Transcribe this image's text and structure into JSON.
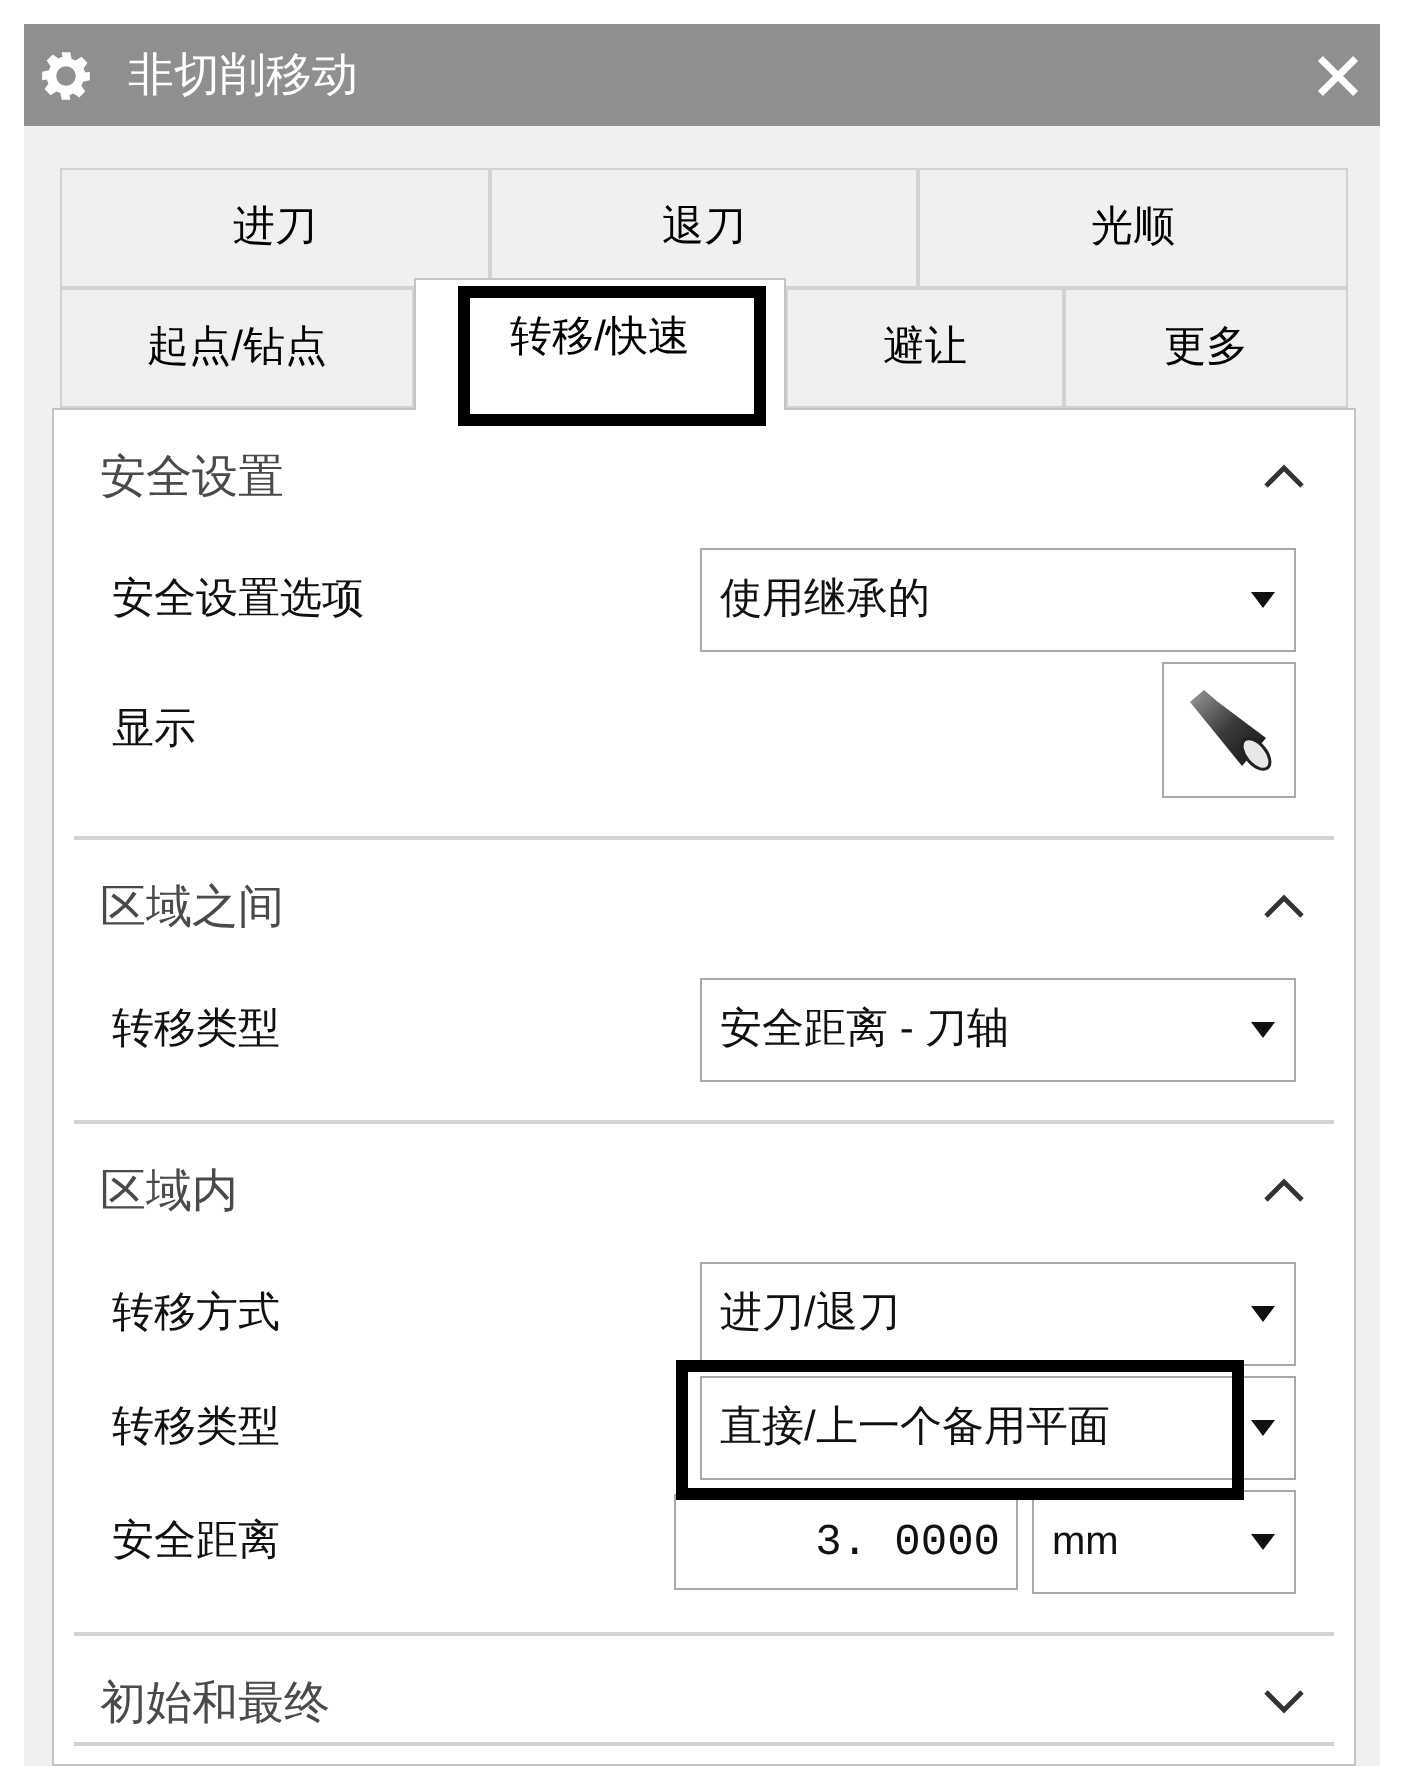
{
  "window": {
    "title": "非切削移动"
  },
  "tab_rows": [
    [
      {
        "label": "进刀",
        "selected": false,
        "highlighted": false
      },
      {
        "label": "退刀",
        "selected": false,
        "highlighted": false
      },
      {
        "label": "光顺",
        "selected": false,
        "highlighted": false
      }
    ],
    [
      {
        "label": "起点/钻点",
        "selected": false,
        "highlighted": false
      },
      {
        "label": "转移/快速",
        "selected": true,
        "highlighted": true
      },
      {
        "label": "避让",
        "selected": false,
        "highlighted": false
      },
      {
        "label": "更多",
        "selected": false,
        "highlighted": false
      }
    ]
  ],
  "sections": [
    {
      "title": "安全设置",
      "expanded": true,
      "rows": [
        {
          "kind": "dropdown",
          "label": "安全设置选项",
          "value": "使用继承的",
          "highlighted": false
        },
        {
          "kind": "display_button",
          "label": "显示",
          "highlighted": false
        }
      ]
    },
    {
      "title": "区域之间",
      "expanded": true,
      "rows": [
        {
          "kind": "dropdown",
          "label": "转移类型",
          "value": "安全距离 - 刀轴",
          "highlighted": false
        }
      ]
    },
    {
      "title": "区域内",
      "expanded": true,
      "rows": [
        {
          "kind": "dropdown",
          "label": "转移方式",
          "value": "进刀/退刀",
          "highlighted": false
        },
        {
          "kind": "dropdown",
          "label": "转移类型",
          "value": "直接/上一个备用平面",
          "highlighted": true
        },
        {
          "kind": "measure",
          "label": "安全距离",
          "value": "3. 0000",
          "unit": "mm",
          "highlighted": false
        }
      ]
    },
    {
      "title": "初始和最终",
      "expanded": false
    }
  ]
}
